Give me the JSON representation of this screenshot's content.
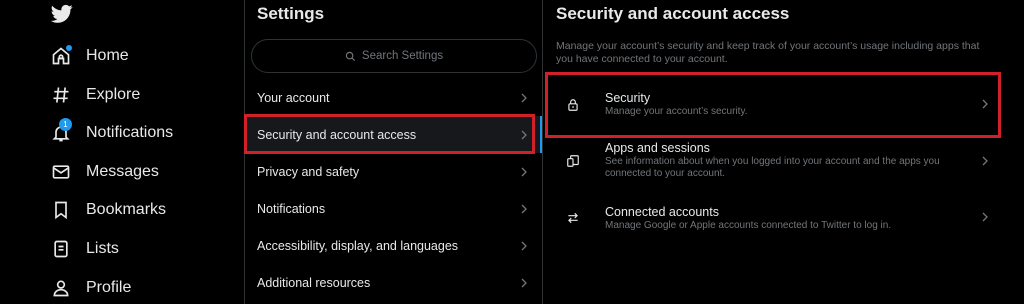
{
  "nav": {
    "items": [
      {
        "label": "Home",
        "icon": "home-icon"
      },
      {
        "label": "Explore",
        "icon": "hashtag-icon"
      },
      {
        "label": "Notifications",
        "icon": "bell-icon",
        "badge": "1"
      },
      {
        "label": "Messages",
        "icon": "envelope-icon"
      },
      {
        "label": "Bookmarks",
        "icon": "bookmark-icon"
      },
      {
        "label": "Lists",
        "icon": "list-icon"
      },
      {
        "label": "Profile",
        "icon": "person-icon"
      }
    ]
  },
  "settings": {
    "title": "Settings",
    "search_placeholder": "Search Settings",
    "items": [
      {
        "label": "Your account"
      },
      {
        "label": "Security and account access"
      },
      {
        "label": "Privacy and safety"
      },
      {
        "label": "Notifications"
      },
      {
        "label": "Accessibility, display, and languages"
      },
      {
        "label": "Additional resources"
      }
    ]
  },
  "detail": {
    "title": "Security and account access",
    "description": "Manage your account’s security and keep track of your account’s usage including apps that you have connected to your account.",
    "options": [
      {
        "title": "Security",
        "subtitle": "Manage your account’s security.",
        "icon": "lock-icon"
      },
      {
        "title": "Apps and sessions",
        "subtitle": "See information about when you logged into your account and the apps you connected to your account.",
        "icon": "devices-icon"
      },
      {
        "title": "Connected accounts",
        "subtitle": "Manage Google or Apple accounts connected to Twitter to log in.",
        "icon": "swap-arrows-icon"
      }
    ]
  },
  "colors": {
    "background": "#000000",
    "accent": "#1d9bf0",
    "highlight": "#d0202a",
    "muted_text": "#71767b"
  }
}
